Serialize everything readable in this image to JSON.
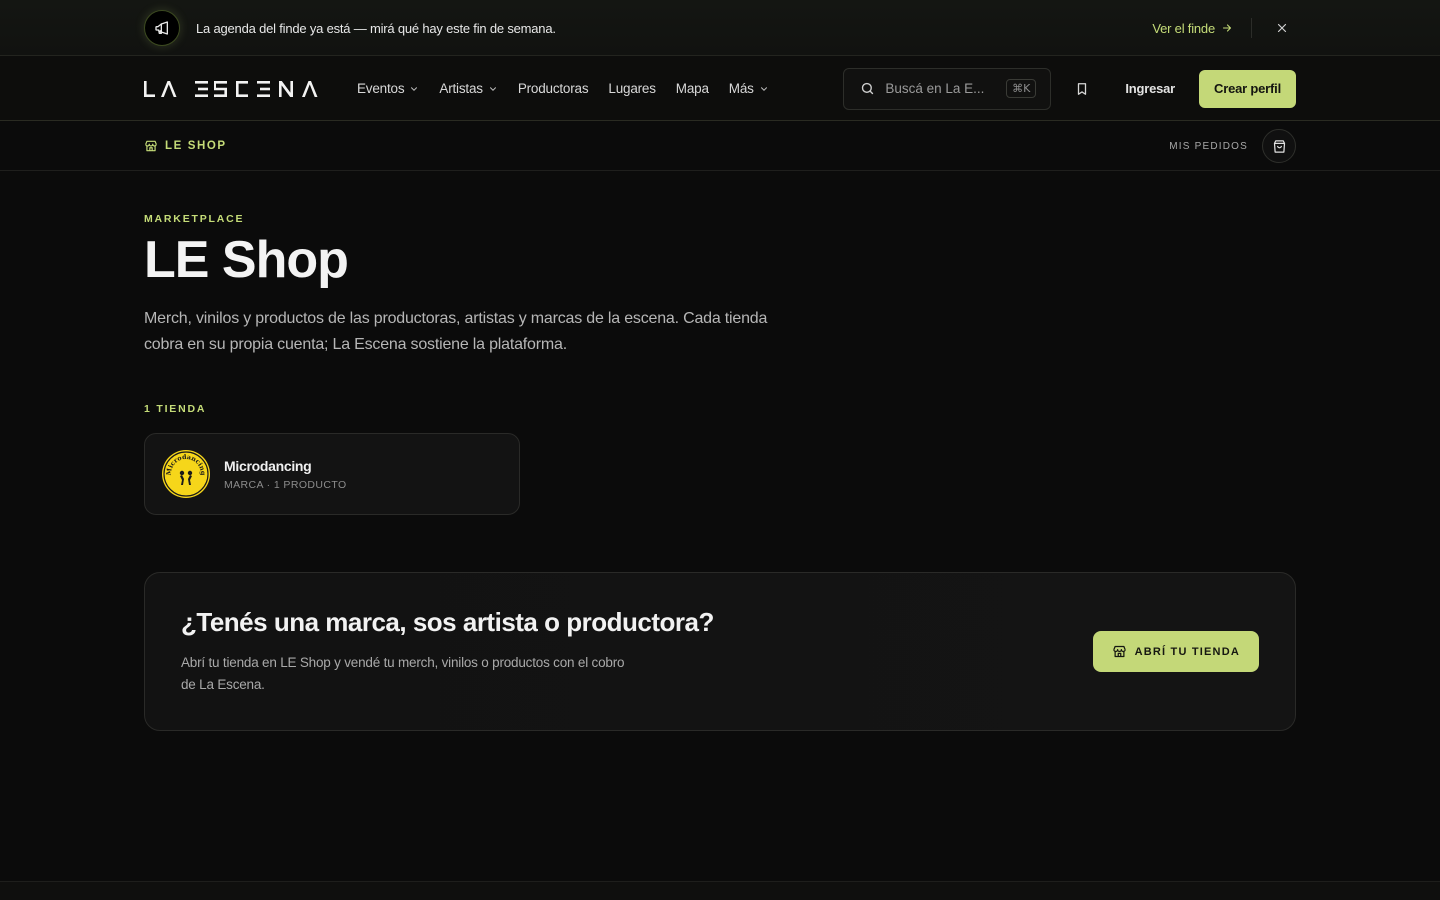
{
  "announcement": {
    "text": "La agenda del finde ya está — mirá qué hay este fin de semana.",
    "link_label": "Ver el finde",
    "icon": "megaphone-icon"
  },
  "nav": {
    "logo": "LA ESCENA",
    "menu": [
      {
        "label": "Eventos",
        "dropdown": true
      },
      {
        "label": "Artistas",
        "dropdown": true
      },
      {
        "label": "Productoras",
        "dropdown": false
      },
      {
        "label": "Lugares",
        "dropdown": false
      },
      {
        "label": "Mapa",
        "dropdown": false
      },
      {
        "label": "Más",
        "dropdown": true
      }
    ],
    "search_placeholder": "Buscá en La E...",
    "search_shortcut": "⌘K",
    "login_label": "Ingresar",
    "cta_label": "Crear perfil"
  },
  "subnav": {
    "title": "LE SHOP",
    "orders_label": "MIS PEDIDOS"
  },
  "hero": {
    "eyebrow": "MARKETPLACE",
    "title": "LE Shop",
    "lead": "Merch, vinilos y productos de las productoras, artistas y marcas de la escena. Cada tienda cobra en su propia cuenta; La Escena sostiene la plataforma."
  },
  "stores": {
    "count_label": "1 TIENDA",
    "items": [
      {
        "name": "Microdancing",
        "meta": "MARCA · 1 PRODUCTO",
        "avatar_text": "Microdancing"
      }
    ]
  },
  "banner": {
    "title": "¿Tenés una marca, sos artista o productora?",
    "description": "Abrí tu tienda en LE Shop y vendé tu merch, vinilos o productos con el cobro de La Escena.",
    "button_label": "ABRÍ TU TIENDA"
  },
  "colors": {
    "accent": "#c4d878",
    "background": "#0b0b0b",
    "avatar_yellow": "#f6d61a"
  }
}
